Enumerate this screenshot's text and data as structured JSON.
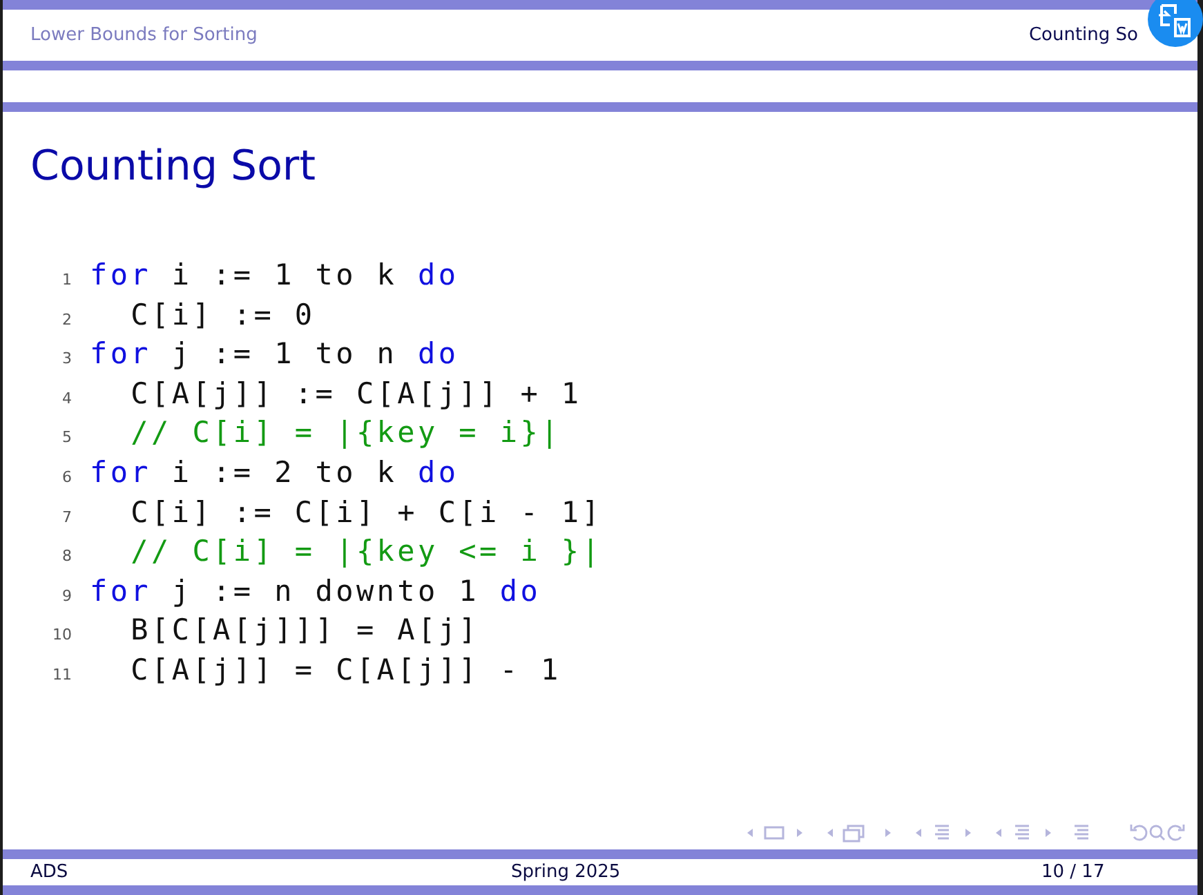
{
  "header": {
    "section": "Lower Bounds for Sorting",
    "subsection": "Counting So"
  },
  "title": "Counting Sort",
  "code": [
    {
      "number": "1",
      "parts": [
        {
          "kind": "keyword",
          "text": "for"
        },
        {
          "kind": "plain",
          "text": " i := 1 to k "
        },
        {
          "kind": "keyword",
          "text": "do"
        }
      ]
    },
    {
      "number": "2",
      "parts": [
        {
          "kind": "plain",
          "text": "  C[i] := 0"
        }
      ]
    },
    {
      "number": "3",
      "parts": [
        {
          "kind": "keyword",
          "text": "for"
        },
        {
          "kind": "plain",
          "text": " j := 1 to n "
        },
        {
          "kind": "keyword",
          "text": "do"
        }
      ]
    },
    {
      "number": "4",
      "parts": [
        {
          "kind": "plain",
          "text": "  C[A[j]] := C[A[j]] + 1"
        }
      ]
    },
    {
      "number": "5",
      "parts": [
        {
          "kind": "comment",
          "text": "  // C[i] = |{key = i}|"
        }
      ]
    },
    {
      "number": "6",
      "parts": [
        {
          "kind": "keyword",
          "text": "for"
        },
        {
          "kind": "plain",
          "text": " i := 2 to k "
        },
        {
          "kind": "keyword",
          "text": "do"
        }
      ]
    },
    {
      "number": "7",
      "parts": [
        {
          "kind": "plain",
          "text": "  C[i] := C[i] + C[i - 1]"
        }
      ]
    },
    {
      "number": "8",
      "parts": [
        {
          "kind": "comment",
          "text": "  // C[i] = |{key <= i }|"
        }
      ]
    },
    {
      "number": "9",
      "parts": [
        {
          "kind": "keyword",
          "text": "for"
        },
        {
          "kind": "plain",
          "text": " j := n downto 1 "
        },
        {
          "kind": "keyword",
          "text": "do"
        }
      ]
    },
    {
      "number": "10",
      "parts": [
        {
          "kind": "plain",
          "text": "  B[C[A[j]]] = A[j]"
        }
      ]
    },
    {
      "number": "11",
      "parts": [
        {
          "kind": "plain",
          "text": "  C[A[j]] = C[A[j]] - 1"
        }
      ]
    }
  ],
  "footer": {
    "left": "ADS",
    "center": "Spring 2025",
    "right": "10 / 17"
  }
}
